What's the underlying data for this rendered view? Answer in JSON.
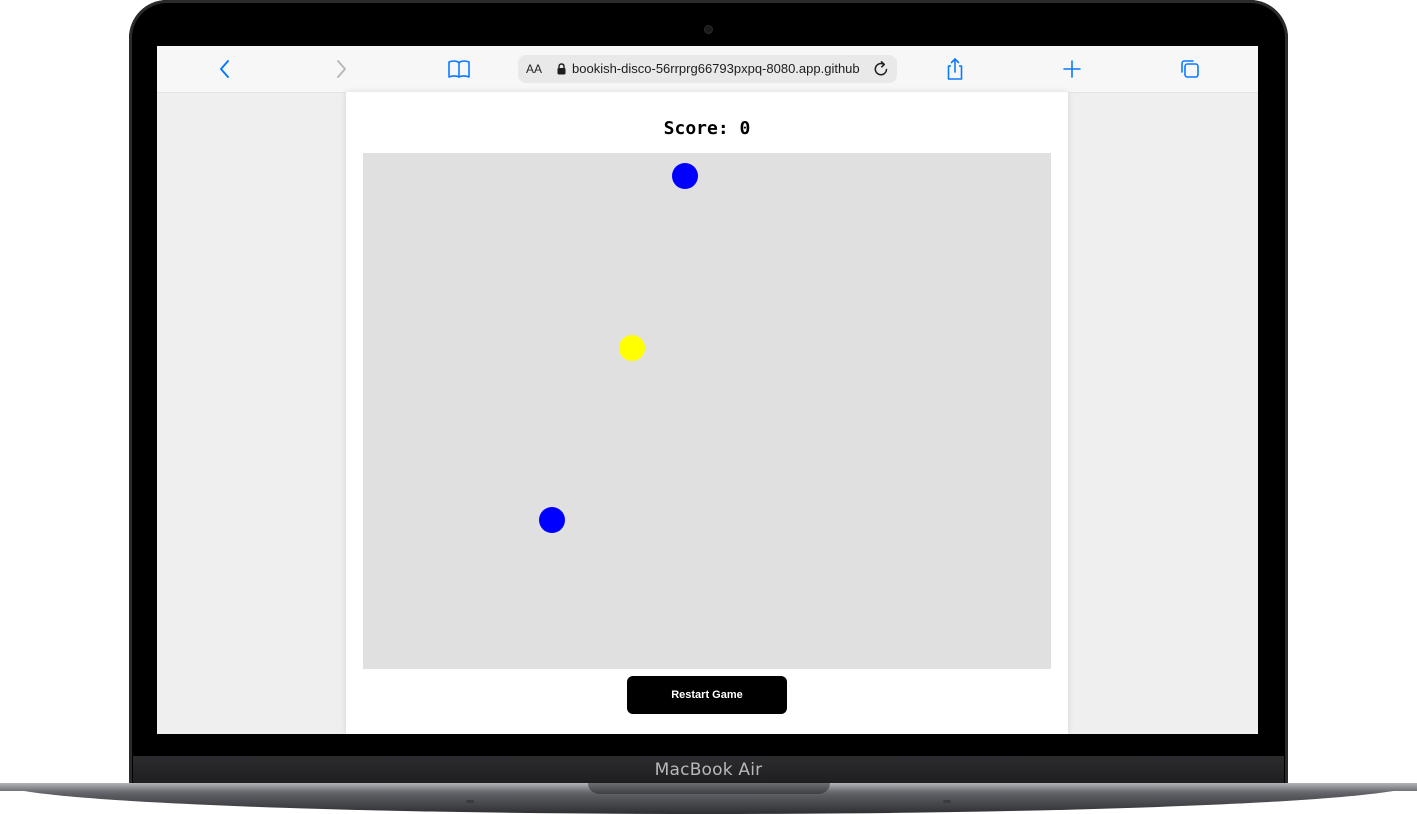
{
  "device": {
    "model_label": "MacBook Air"
  },
  "browser": {
    "text_size_label": "AA",
    "url": "bookish-disco-56rrprg66793pxpq-8080.app.github",
    "icons": {
      "back": "chevron-left-icon",
      "forward": "chevron-right-icon",
      "bookmarks": "book-icon",
      "lock": "lock-icon",
      "reload": "reload-icon",
      "share": "share-icon",
      "new_tab": "plus-icon",
      "tabs": "tabs-icon"
    },
    "accent_color": "#0a7aff"
  },
  "game": {
    "score_text": "Score: 0",
    "restart_label": "Restart Game",
    "area_color": "#e0e0e0",
    "balls": [
      {
        "name": "blue-ball-top",
        "color": "#0000ff"
      },
      {
        "name": "yellow-ball",
        "color": "#ffff00"
      },
      {
        "name": "blue-ball-bottom",
        "color": "#0000ff"
      }
    ]
  }
}
